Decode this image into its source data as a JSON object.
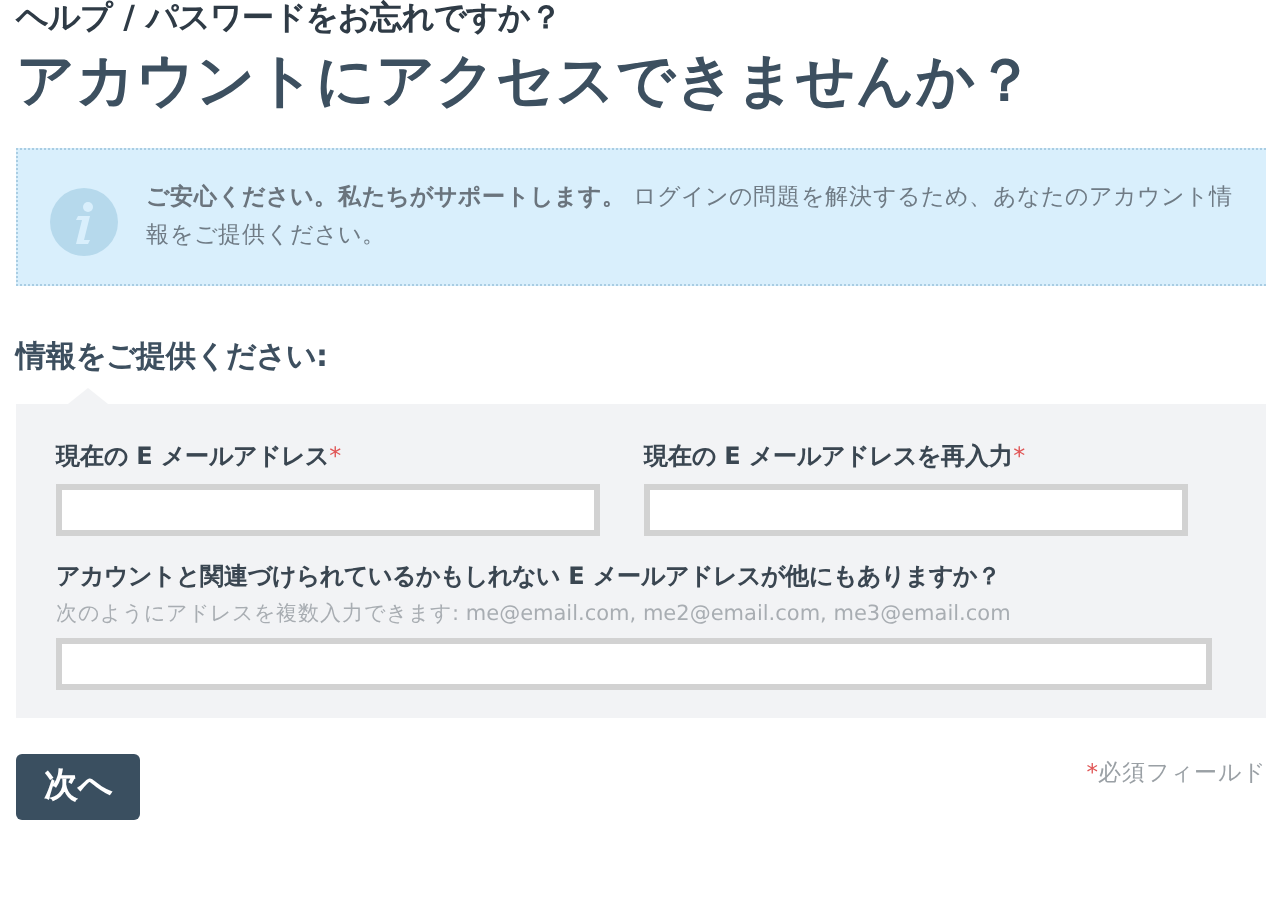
{
  "breadcrumb": "ヘルプ / パスワードをお忘れですか？",
  "title": "アカウントにアクセスできませんか？",
  "notice": {
    "lead": "ご安心ください。私たちがサポートします。",
    "text": "ログインの問題を解決するため、あなたのアカウント情報をご提供ください。"
  },
  "section_title": "情報をご提供ください:",
  "fields": [
    {
      "label": "現在の E メールアドレス",
      "mark": "*",
      "kind": "half"
    },
    {
      "label": "現在の E メールアドレスを再入力",
      "mark": "*",
      "kind": "half"
    },
    {
      "label": "アカウントと関連づけられているかもしれない E メールアドレスが他にもありますか？",
      "hint": "次のようにアドレスを複数入力できます: me@email.com, me2@email.com, me3@email.com",
      "kind": "full"
    }
  ],
  "required_note": {
    "mark": "*",
    "text": "必須フィールド"
  },
  "buttons": [
    "次へ"
  ]
}
